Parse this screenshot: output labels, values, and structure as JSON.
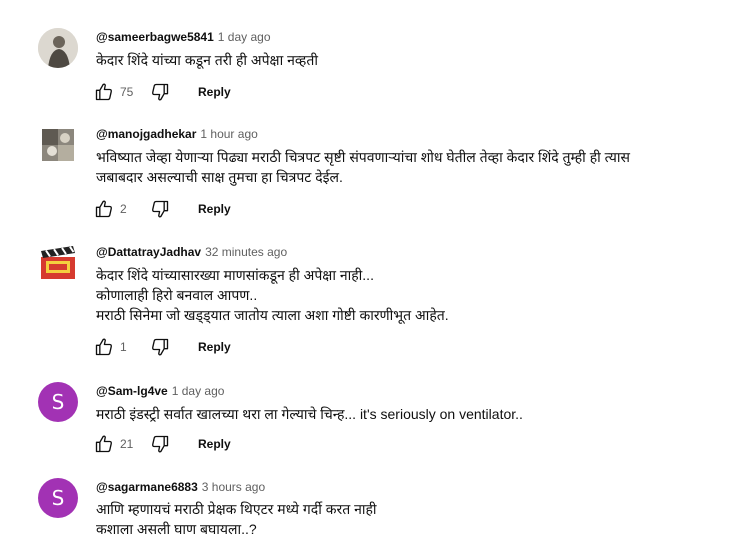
{
  "comments": [
    {
      "author": "@sameerbagwe5841",
      "time": "1 day ago",
      "lines": [
        "केदार शिंदे यांच्या कडून तरी ही अपेक्षा नव्हती"
      ],
      "likes": "75",
      "reply": "Reply",
      "avatar": {
        "type": "photo",
        "color": "#b8b2a8"
      }
    },
    {
      "author": "@manojgadhekar",
      "time": "1 hour ago",
      "lines": [
        "भविष्यात जेव्हा येणाऱ्या पिढ्या मराठी चित्रपट सृष्टी संपवणाऱ्यांचा शोध घेतील तेव्हा केदार शिंदे तुम्ही ही त्यास",
        "जबाबदार असल्याची साक्ष तुमचा हा चित्रपट देईल."
      ],
      "likes": "2",
      "reply": "Reply",
      "avatar": {
        "type": "photo",
        "color": "#6f6b62"
      }
    },
    {
      "author": "@DattatrayJadhav",
      "time": "32 minutes ago",
      "lines": [
        "केदार शिंदे यांच्यासारख्या माणसांकडून ही अपेक्षा नाही...",
        "कोणालाही हिरो बनवाल आपण..",
        "मराठी सिनेमा जो खड्ड्यात जातोय त्याला अशा गोष्टी कारणीभूत आहेत."
      ],
      "likes": "1",
      "reply": "Reply",
      "avatar": {
        "type": "clapper",
        "color": "#d63b2f"
      }
    },
    {
      "author": "@Sam-lg4ve",
      "time": "1 day ago",
      "lines": [
        "मराठी इंडस्ट्री सर्वात खालच्या थरा ला गेल्याचे चिन्ह... it's seriously on ventilator.."
      ],
      "likes": "21",
      "reply": "Reply",
      "avatar": {
        "type": "letter",
        "letter": "S",
        "color": "#a232b4"
      }
    },
    {
      "author": "@sagarmane6883",
      "time": "3 hours ago",
      "lines": [
        "आणि म्हणायचं मराठी प्रेक्षक थिएटर मध्ये गर्दी करत नाही",
        "कशाला असली घाण बघायला..?"
      ],
      "likes": "",
      "reply": "",
      "avatar": {
        "type": "letter",
        "letter": "S",
        "color": "#a232b4"
      }
    }
  ]
}
